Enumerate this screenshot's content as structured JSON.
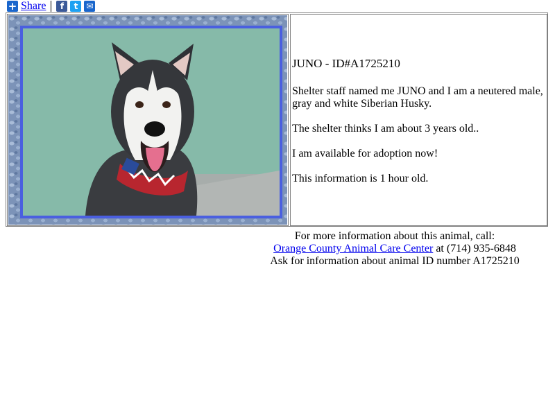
{
  "share": {
    "plus_icon": "plus-icon",
    "label": "Share",
    "social": [
      {
        "name": "facebook-icon",
        "glyph": "f",
        "color": "#3b5998"
      },
      {
        "name": "twitter-icon",
        "glyph": "t",
        "color": "#1da1f2"
      },
      {
        "name": "email-icon",
        "glyph": "✉",
        "color": "#1a66cc"
      }
    ]
  },
  "animal": {
    "title": "JUNO - ID#A1725210",
    "description": "Shelter staff named me JUNO and I am a neutered male, gray and white Siberian Husky.",
    "age": "The shelter thinks I am about 3 years old..",
    "availability": "I am available for adoption now!",
    "freshness": "This information is 1 hour old."
  },
  "footer": {
    "line1": "For more information about this animal, call:",
    "shelter_link": "Orange County Animal Care Center",
    "phone_text": " at (714) 935-6848",
    "line3": "Ask for information about animal ID number A1725210"
  },
  "colors": {
    "link": "#0000ee",
    "photo_border": "#4a5fe0",
    "frame_stone": "#7c93b8"
  }
}
